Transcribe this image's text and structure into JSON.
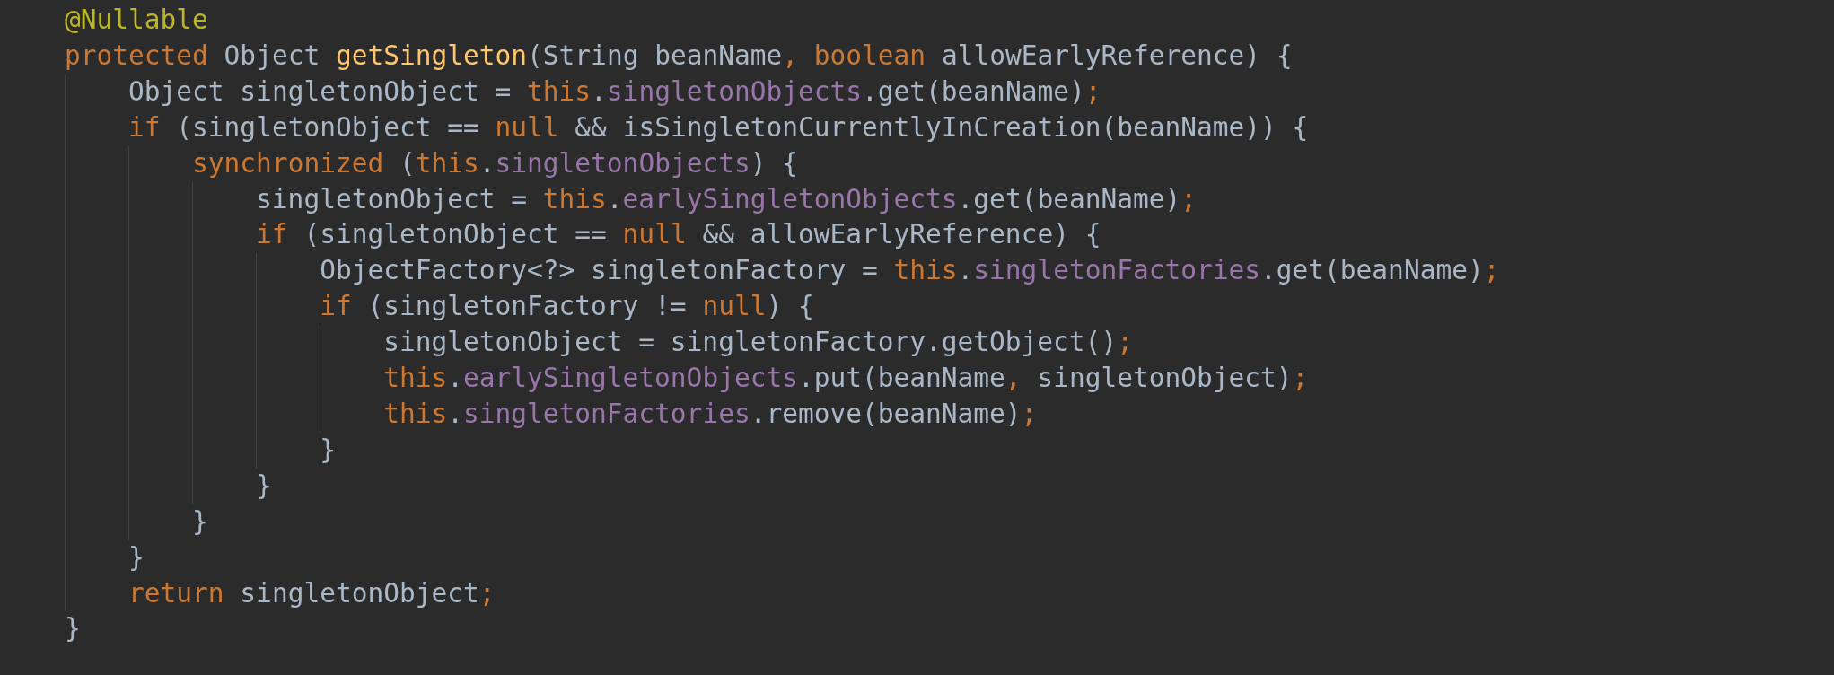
{
  "editor": {
    "lines": [
      {
        "tokens": [
          {
            "kind": "annotation",
            "text": "@Nullable"
          }
        ]
      },
      {
        "tokens": [
          {
            "kind": "keyword",
            "text": "protected "
          },
          {
            "kind": "plain",
            "text": "Object "
          },
          {
            "kind": "method",
            "text": "getSingleton"
          },
          {
            "kind": "plain",
            "text": "(String beanName"
          },
          {
            "kind": "punct",
            "text": ","
          },
          {
            "kind": "keyword",
            "text": " boolean "
          },
          {
            "kind": "plain",
            "text": "allowEarlyReference) {"
          }
        ],
        "children": [
          {
            "tokens": [
              {
                "kind": "plain",
                "text": "Object singletonObject = "
              },
              {
                "kind": "keyword",
                "text": "this"
              },
              {
                "kind": "plain",
                "text": "."
              },
              {
                "kind": "field",
                "text": "singletonObjects"
              },
              {
                "kind": "plain",
                "text": ".get(beanName)"
              },
              {
                "kind": "punct",
                "text": ";"
              }
            ]
          },
          {
            "tokens": [
              {
                "kind": "keyword",
                "text": "if "
              },
              {
                "kind": "plain",
                "text": "(singletonObject == "
              },
              {
                "kind": "keyword",
                "text": "null "
              },
              {
                "kind": "plain",
                "text": "&& isSingletonCurrentlyInCreation(beanName)) {"
              }
            ],
            "children": [
              {
                "tokens": [
                  {
                    "kind": "keyword",
                    "text": "synchronized "
                  },
                  {
                    "kind": "plain",
                    "text": "("
                  },
                  {
                    "kind": "keyword",
                    "text": "this"
                  },
                  {
                    "kind": "plain",
                    "text": "."
                  },
                  {
                    "kind": "field",
                    "text": "singletonObjects"
                  },
                  {
                    "kind": "plain",
                    "text": ") {"
                  }
                ],
                "children": [
                  {
                    "tokens": [
                      {
                        "kind": "plain",
                        "text": "singletonObject = "
                      },
                      {
                        "kind": "keyword",
                        "text": "this"
                      },
                      {
                        "kind": "plain",
                        "text": "."
                      },
                      {
                        "kind": "field",
                        "text": "earlySingletonObjects"
                      },
                      {
                        "kind": "plain",
                        "text": ".get(beanName)"
                      },
                      {
                        "kind": "punct",
                        "text": ";"
                      }
                    ]
                  },
                  {
                    "tokens": [
                      {
                        "kind": "keyword",
                        "text": "if "
                      },
                      {
                        "kind": "plain",
                        "text": "(singletonObject == "
                      },
                      {
                        "kind": "keyword",
                        "text": "null "
                      },
                      {
                        "kind": "plain",
                        "text": "&& allowEarlyReference) {"
                      }
                    ],
                    "children": [
                      {
                        "tokens": [
                          {
                            "kind": "plain",
                            "text": "ObjectFactory<?> singletonFactory = "
                          },
                          {
                            "kind": "keyword",
                            "text": "this"
                          },
                          {
                            "kind": "plain",
                            "text": "."
                          },
                          {
                            "kind": "field",
                            "text": "singletonFactories"
                          },
                          {
                            "kind": "plain",
                            "text": ".get(beanName)"
                          },
                          {
                            "kind": "punct",
                            "text": ";"
                          }
                        ]
                      },
                      {
                        "tokens": [
                          {
                            "kind": "keyword",
                            "text": "if "
                          },
                          {
                            "kind": "plain",
                            "text": "(singletonFactory != "
                          },
                          {
                            "kind": "keyword",
                            "text": "null"
                          },
                          {
                            "kind": "plain",
                            "text": ") {"
                          }
                        ],
                        "children": [
                          {
                            "tokens": [
                              {
                                "kind": "plain",
                                "text": "singletonObject = singletonFactory.getObject()"
                              },
                              {
                                "kind": "punct",
                                "text": ";"
                              }
                            ]
                          },
                          {
                            "tokens": [
                              {
                                "kind": "keyword",
                                "text": "this"
                              },
                              {
                                "kind": "plain",
                                "text": "."
                              },
                              {
                                "kind": "field",
                                "text": "earlySingletonObjects"
                              },
                              {
                                "kind": "plain",
                                "text": ".put(beanName"
                              },
                              {
                                "kind": "punct",
                                "text": ","
                              },
                              {
                                "kind": "plain",
                                "text": " singletonObject)"
                              },
                              {
                                "kind": "punct",
                                "text": ";"
                              }
                            ]
                          },
                          {
                            "tokens": [
                              {
                                "kind": "keyword",
                                "text": "this"
                              },
                              {
                                "kind": "plain",
                                "text": "."
                              },
                              {
                                "kind": "field",
                                "text": "singletonFactories"
                              },
                              {
                                "kind": "plain",
                                "text": ".remove(beanName)"
                              },
                              {
                                "kind": "punct",
                                "text": ";"
                              }
                            ]
                          }
                        ]
                      },
                      {
                        "tokens": [
                          {
                            "kind": "plain",
                            "text": "}"
                          }
                        ]
                      }
                    ]
                  },
                  {
                    "tokens": [
                      {
                        "kind": "plain",
                        "text": "}"
                      }
                    ]
                  }
                ]
              },
              {
                "tokens": [
                  {
                    "kind": "plain",
                    "text": "}"
                  }
                ]
              }
            ]
          },
          {
            "tokens": [
              {
                "kind": "plain",
                "text": "}"
              }
            ]
          },
          {
            "tokens": [
              {
                "kind": "keyword",
                "text": "return "
              },
              {
                "kind": "plain",
                "text": "singletonObject"
              },
              {
                "kind": "punct",
                "text": ";"
              }
            ]
          }
        ]
      },
      {
        "tokens": [
          {
            "kind": "plain",
            "text": "}"
          }
        ]
      }
    ]
  }
}
